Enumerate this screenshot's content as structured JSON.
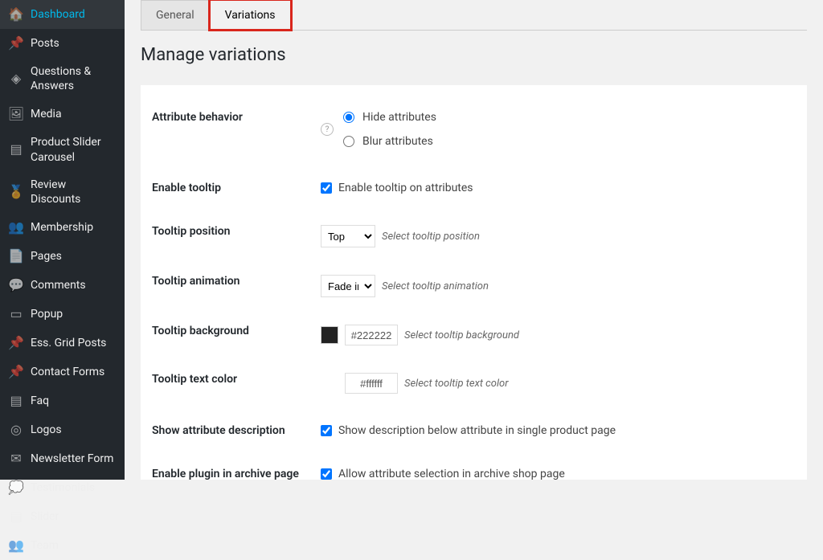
{
  "sidebar": {
    "items": [
      {
        "label": "Dashboard",
        "icon": "🏠"
      },
      {
        "label": "Posts",
        "icon": "📌"
      },
      {
        "label": "Questions & Answers",
        "icon": "◈"
      },
      {
        "label": "Media",
        "icon": "🖼"
      },
      {
        "label": "Product Slider Carousel",
        "icon": "▤"
      },
      {
        "label": "Review Discounts",
        "icon": "🏅"
      },
      {
        "label": "Membership",
        "icon": "👥"
      },
      {
        "label": "Pages",
        "icon": "📄"
      },
      {
        "label": "Comments",
        "icon": "💬"
      },
      {
        "label": "Popup",
        "icon": "▭"
      },
      {
        "label": "Ess. Grid Posts",
        "icon": "📌"
      },
      {
        "label": "Contact Forms",
        "icon": "📌"
      },
      {
        "label": "Faq",
        "icon": "▤"
      },
      {
        "label": "Logos",
        "icon": "◎"
      },
      {
        "label": "Newsletter Form",
        "icon": "✉"
      },
      {
        "label": "Testimonials",
        "icon": "💭"
      },
      {
        "label": "Slider",
        "icon": "▤"
      },
      {
        "label": "Team",
        "icon": "👥"
      }
    ]
  },
  "tabs": {
    "general": "General",
    "variations": "Variations"
  },
  "section": {
    "title": "Manage variations"
  },
  "fields": {
    "attribute_behavior": {
      "label": "Attribute behavior",
      "options": {
        "hide": "Hide attributes",
        "blur": "Blur attributes"
      }
    },
    "enable_tooltip": {
      "label": "Enable tooltip",
      "text": "Enable tooltip on attributes"
    },
    "tooltip_position": {
      "label": "Tooltip position",
      "value": "Top",
      "hint": "Select tooltip position"
    },
    "tooltip_animation": {
      "label": "Tooltip animation",
      "value": "Fade in",
      "hint": "Select tooltip animation"
    },
    "tooltip_background": {
      "label": "Tooltip background",
      "value": "#222222",
      "hint": "Select tooltip background",
      "swatch": "#222222"
    },
    "tooltip_text_color": {
      "label": "Tooltip text color",
      "value": "#ffffff",
      "hint": "Select tooltip text color"
    },
    "show_attr_desc": {
      "label": "Show attribute description",
      "text": "Show description below attribute in single product page"
    },
    "enable_archive": {
      "label": "Enable plugin in archive page",
      "text": "Allow attribute selection in archive shop page"
    }
  }
}
